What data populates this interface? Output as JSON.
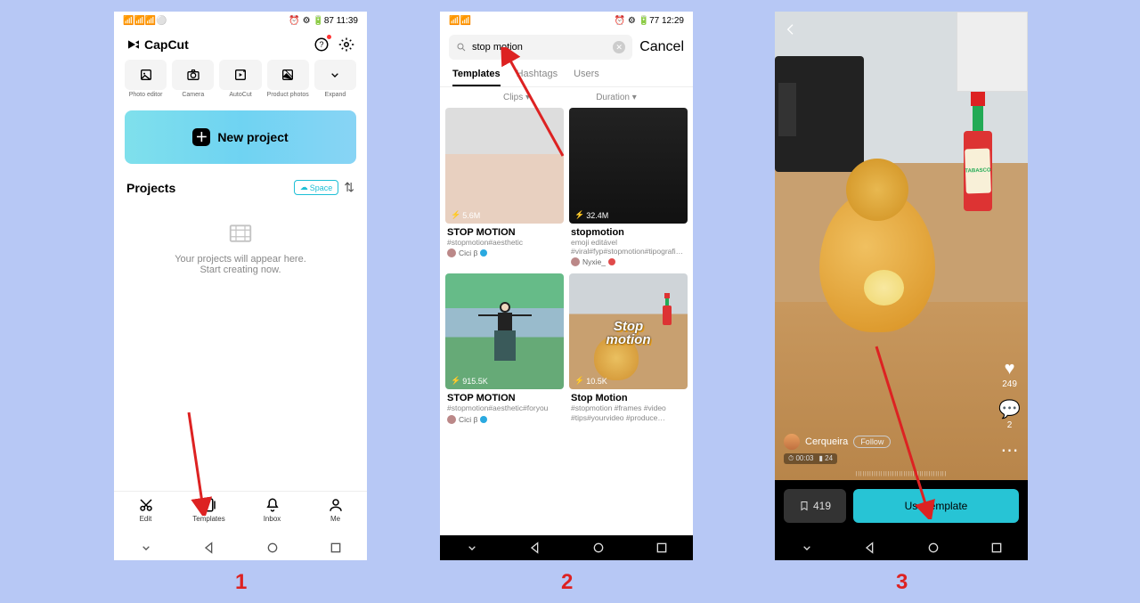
{
  "screen1": {
    "status": {
      "left": "📶📶📶⚪",
      "right": "⏰ ⚙ 🔋87 11:39"
    },
    "app_name": "CapCut",
    "tools": [
      {
        "label": "Photo editor"
      },
      {
        "label": "Camera"
      },
      {
        "label": "AutoCut"
      },
      {
        "label": "Product photos"
      },
      {
        "label": "Expand"
      }
    ],
    "new_project": "New project",
    "projects_heading": "Projects",
    "space_button": "Space",
    "empty_line1": "Your projects will appear here.",
    "empty_line2": "Start creating now.",
    "bottom_nav": [
      {
        "label": "Edit"
      },
      {
        "label": "Templates"
      },
      {
        "label": "Inbox"
      },
      {
        "label": "Me"
      }
    ]
  },
  "screen2": {
    "status": {
      "left": "📶📶",
      "right": "⏰ ⚙ 🔋77 12:29"
    },
    "search_value": "stop motion",
    "cancel": "Cancel",
    "tabs": [
      {
        "label": "Templates",
        "active": true
      },
      {
        "label": "Hashtags",
        "active": false
      },
      {
        "label": "Users",
        "active": false
      }
    ],
    "filters": {
      "clips": "Clips ▾",
      "duration": "Duration ▾"
    },
    "cards": [
      {
        "views": "5.6M",
        "title": "STOP MOTION",
        "tags": "#stopmotion#aesthetic",
        "author": "Cici β",
        "verify": "blue"
      },
      {
        "views": "32.4M",
        "title": "stopmotion",
        "tags": "emoji editável #viral#fyp#stopmotion#tipografi…",
        "author": "Nyxie_",
        "verify": "red"
      },
      {
        "views": "915.5K",
        "title": "STOP MOTION",
        "tags": "#stopmotion#aesthetic#foryou",
        "author": "Cici β",
        "verify": "blue"
      },
      {
        "views": "10.5K",
        "title": "Stop Motion",
        "tags": "#stopmotion #frames #video #tips#yourvideo #produce…",
        "author": "",
        "verify": ""
      }
    ],
    "overlay_text": "Stop\nmotion"
  },
  "screen3": {
    "brand_label": "TABASCO",
    "author": "Cerqueira",
    "follow": "Follow",
    "duration": "00:03",
    "clips": "24",
    "like_count": "249",
    "comment_count": "2",
    "bookmark_count": "419",
    "use_template": "Use template"
  },
  "step_labels": [
    "1",
    "2",
    "3"
  ]
}
